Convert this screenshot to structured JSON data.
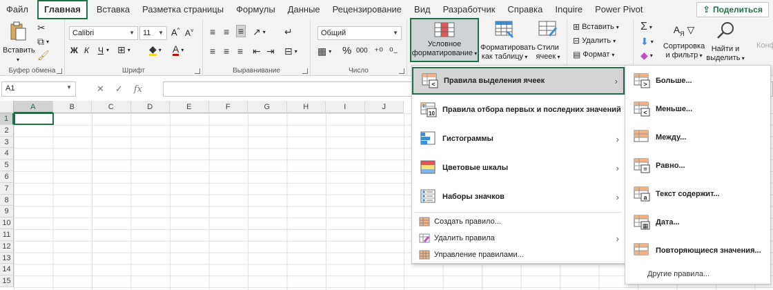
{
  "tabs": [
    {
      "label": "Файл",
      "active": false
    },
    {
      "label": "Главная",
      "active": true
    },
    {
      "label": "Вставка",
      "active": false
    },
    {
      "label": "Разметка страницы",
      "active": false
    },
    {
      "label": "Формулы",
      "active": false
    },
    {
      "label": "Данные",
      "active": false
    },
    {
      "label": "Рецензирование",
      "active": false
    },
    {
      "label": "Вид",
      "active": false
    },
    {
      "label": "Разработчик",
      "active": false
    },
    {
      "label": "Справка",
      "active": false
    },
    {
      "label": "Inquire",
      "active": false
    },
    {
      "label": "Power Pivot",
      "active": false
    }
  ],
  "share_label": "Поделиться",
  "ribbon": {
    "clipboard": {
      "paste": "Вставить",
      "group": "Буфер обмена"
    },
    "font": {
      "name": "Calibri",
      "size": "11",
      "bold": "Ж",
      "italic": "К",
      "underline": "Ч",
      "group": "Шрифт"
    },
    "alignment": {
      "group": "Выравнивание"
    },
    "number": {
      "format": "Общий",
      "percent": "%",
      "thousands": "000",
      "group": "Число"
    },
    "styles": {
      "conditional_line1": "Условное",
      "conditional_line2": "форматирование",
      "format_table_line1": "Форматировать",
      "format_table_line2": "как таблицу",
      "cell_styles_line1": "Стили",
      "cell_styles_line2": "ячеек"
    },
    "cells": {
      "insert": "Вставить",
      "delete": "Удалить",
      "format": "Формат"
    },
    "editing": {
      "sort_line1": "Сортировка",
      "sort_line2": "и фильтр",
      "find_line1": "Найти и",
      "find_line2": "выделить",
      "overflow": "Конф"
    }
  },
  "namebox": "A1",
  "columns": [
    "A",
    "B",
    "C",
    "D",
    "E",
    "F",
    "G",
    "H",
    "I",
    "J"
  ],
  "rows": [
    "1",
    "2",
    "3",
    "4",
    "5",
    "6",
    "7",
    "8",
    "9",
    "10",
    "11",
    "12",
    "13",
    "14",
    "15"
  ],
  "menu_main": {
    "items": [
      {
        "label": "Правила выделения ячеек",
        "icon": "highlight-rules-icon"
      },
      {
        "label": "Правила отбора первых и последних значений",
        "icon": "top-bottom-rules-icon"
      },
      {
        "label": "Гистограммы",
        "icon": "data-bars-icon"
      },
      {
        "label": "Цветовые шкалы",
        "icon": "color-scales-icon"
      },
      {
        "label": "Наборы значков",
        "icon": "icon-sets-icon"
      }
    ],
    "small_items": [
      {
        "label": "Создать правило..."
      },
      {
        "label": "Удалить правила"
      },
      {
        "label": "Управление правилами..."
      }
    ]
  },
  "menu_sub": {
    "items": [
      {
        "label": "Больше..."
      },
      {
        "label": "Меньше..."
      },
      {
        "label": "Между..."
      },
      {
        "label": "Равно..."
      },
      {
        "label": "Текст содержит..."
      },
      {
        "label": "Дата..."
      },
      {
        "label": "Повторяющиеся значения..."
      }
    ],
    "other": "Другие правила..."
  },
  "colors": {
    "accent": "#1e7145",
    "icon_orange": "#f4b183",
    "icon_red": "#e05757",
    "icon_blue": "#3b8fd6"
  }
}
